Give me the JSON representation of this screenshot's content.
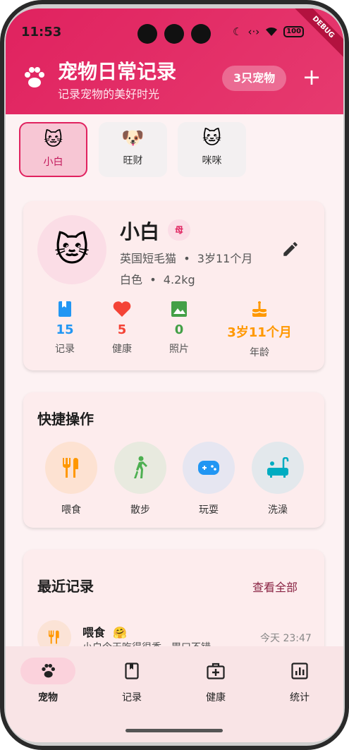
{
  "status": {
    "time": "11:53",
    "battery": "100",
    "debug_banner": "DEBUG"
  },
  "header": {
    "title": "宠物日常记录",
    "subtitle": "记录宠物的美好时光",
    "pet_count": "3只宠物",
    "add": "+"
  },
  "pets": [
    {
      "name": "小白",
      "emoji": "🐱",
      "active": true
    },
    {
      "name": "旺财",
      "emoji": "🐶",
      "active": false
    },
    {
      "name": "咪咪",
      "emoji": "🐱",
      "active": false
    }
  ],
  "profile": {
    "avatar": "🐱",
    "name": "小白",
    "sex": "母",
    "breed": "英国短毛猫",
    "age": "3岁11个月",
    "color": "白色",
    "weight": "4.2kg",
    "sep": "•",
    "stats": [
      {
        "icon": "book-icon",
        "value": "15",
        "label": "记录",
        "color": "#2196f3"
      },
      {
        "icon": "heart-icon",
        "value": "5",
        "label": "健康",
        "color": "#f44336"
      },
      {
        "icon": "image-icon",
        "value": "0",
        "label": "照片",
        "color": "#43a047"
      },
      {
        "icon": "cake-icon",
        "value": "3岁11个月",
        "label": "年龄",
        "color": "#ff9800"
      }
    ]
  },
  "quick": {
    "title": "快捷操作",
    "actions": [
      {
        "icon": "utensils-icon",
        "label": "喂食",
        "bg": "#fde2d2",
        "color": "#ff9800"
      },
      {
        "icon": "walk-icon",
        "label": "散步",
        "bg": "#e8eadf",
        "color": "#4caf50"
      },
      {
        "icon": "gamepad-icon",
        "label": "玩耍",
        "bg": "#e6e6f1",
        "color": "#2196f3"
      },
      {
        "icon": "bath-icon",
        "label": "洗澡",
        "bg": "#e3e8ec",
        "color": "#00acc1"
      }
    ]
  },
  "recent": {
    "title": "最近记录",
    "view_all": "查看全部",
    "items": [
      {
        "title": "喂食",
        "emoji": "🤗",
        "desc": "小白今天吃得很香，胃口不错",
        "time": "今天 23:47"
      }
    ]
  },
  "nav": [
    {
      "icon": "paw-icon",
      "label": "宠物",
      "active": true
    },
    {
      "icon": "book-icon",
      "label": "记录",
      "active": false
    },
    {
      "icon": "medkit-icon",
      "label": "健康",
      "active": false
    },
    {
      "icon": "chart-icon",
      "label": "统计",
      "active": false
    }
  ]
}
